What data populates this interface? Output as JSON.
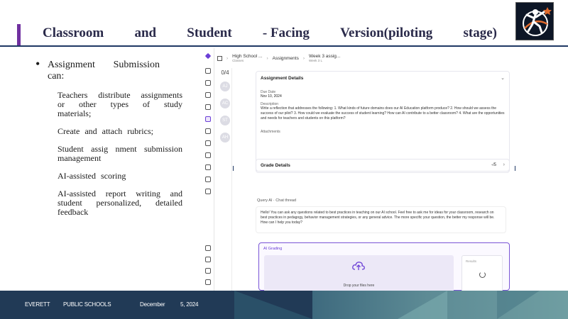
{
  "slide": {
    "title_words": [
      "Classroom",
      "and",
      "Student",
      "- Facing",
      "Version(piloting",
      "stage)"
    ]
  },
  "bullets": {
    "main_line1_words": [
      "Assignment",
      "Submission"
    ],
    "main_line2": "can:",
    "items": [
      "Teachers distribute assignments or other types of study materials;",
      "Create and attach rubrics;",
      "Student assig nment submission management",
      "AI-assisted scoring",
      "AI-assisted report writing and student personalized, detailed feedback"
    ]
  },
  "app": {
    "breadcrumbs": [
      {
        "label": "High School ...",
        "sub": "Classes"
      },
      {
        "label": "Assignments",
        "sub": ""
      },
      {
        "label": "Week 3 assig...",
        "sub": "Week 3 L"
      }
    ],
    "submission_count": "0/4",
    "avatars": [
      "AJ",
      "AC",
      "ST",
      "AH"
    ],
    "assignment_card": {
      "title": "Assignment Details",
      "due_label": "Due Date",
      "due_value": "Nov 10, 2024",
      "desc_label": "Description",
      "desc_text": "Write a reflection that addresses the following: 1. What kinds of future domains does our AI Education platform produce? 2. How should we assess the success of our pilot? 3. How could we evaluate the success of student learning? How can AI contribute to a better classroom? 4. What are the opportunities and needs for teachers and students on this platform?",
      "attachments_label": "Attachments"
    },
    "grade_card": {
      "title": "Grade Details",
      "score": "-/5"
    },
    "chat": {
      "label": "Query AI · Chat thread",
      "text": "Hello! You can ask any questions related to best practices in teaching on our AI school. Feel free to ask me for ideas for your classroom, research on best practices in pedagogy, behavior management strategies, or any general advice. The more specific your question, the better my response will be. How can I help you today?"
    },
    "ai_grading": {
      "title": "AI Grading",
      "drop_text": "Drop your files here",
      "side_title": "Results"
    }
  },
  "footer": {
    "org1": "EVERETT",
    "org2": "PUBLIC SCHOOLS",
    "month": "December",
    "date": "5, 2024"
  },
  "colors": {
    "navy": "#1f3864",
    "accent_purple": "#7030a0",
    "app_purple": "#6b3fd6"
  }
}
